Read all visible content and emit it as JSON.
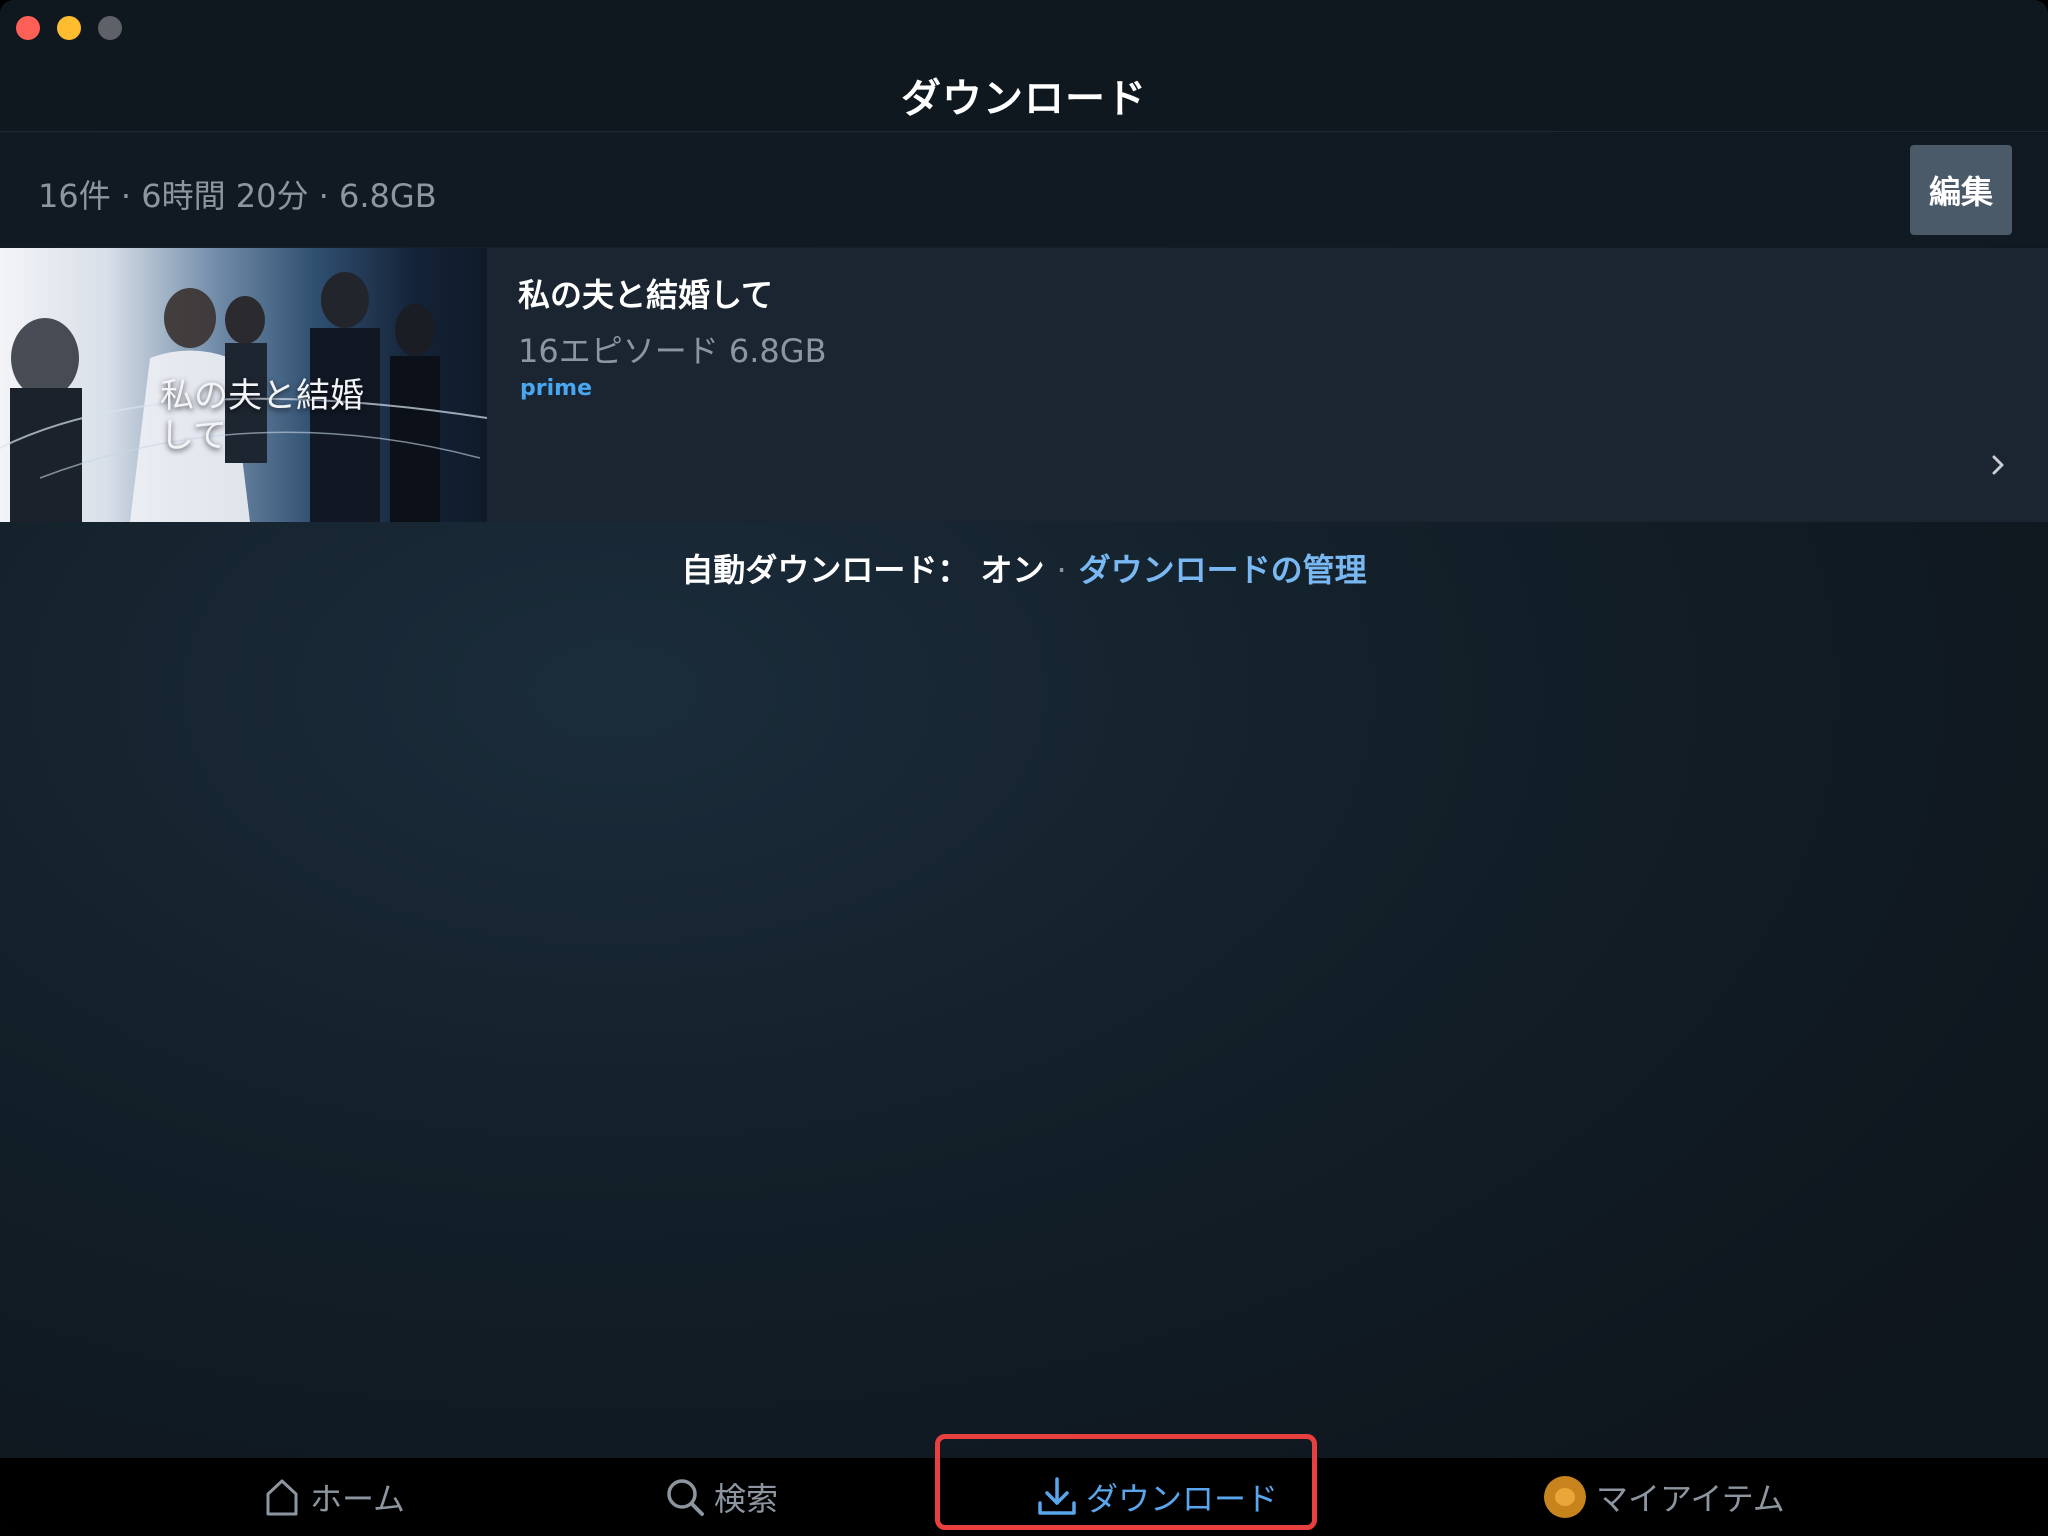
{
  "window": {
    "controls": [
      "close",
      "minimize",
      "maximize"
    ]
  },
  "header": {
    "title": "ダウンロード"
  },
  "summary": {
    "text": "16件 · 6時間 20分 · 6.8GB",
    "edit_label": "編集"
  },
  "downloads": [
    {
      "title": "私の夫と結婚して",
      "meta": "16エピソード 6.8GB",
      "badge": "prime",
      "thumbnail_caption": "私の夫と結婚して",
      "chevron_icon": "chevron-right-icon"
    }
  ],
  "auto_download": {
    "label": "自動ダウンロード： オン",
    "separator": "·",
    "manage_link": "ダウンロードの管理"
  },
  "tabs": [
    {
      "label": "ホーム",
      "icon": "home-icon",
      "active": false
    },
    {
      "label": "検索",
      "icon": "search-icon",
      "active": false
    },
    {
      "label": "ダウンロード",
      "icon": "download-icon",
      "active": true
    },
    {
      "label": "マイアイテム",
      "icon": "avatar-icon",
      "active": false
    }
  ],
  "colors": {
    "accent": "#5aa6ec",
    "link": "#79b8f2",
    "prime_badge": "#48a7f0",
    "highlight_box": "#e8403f",
    "edit_button_bg": "#4b5a69"
  }
}
